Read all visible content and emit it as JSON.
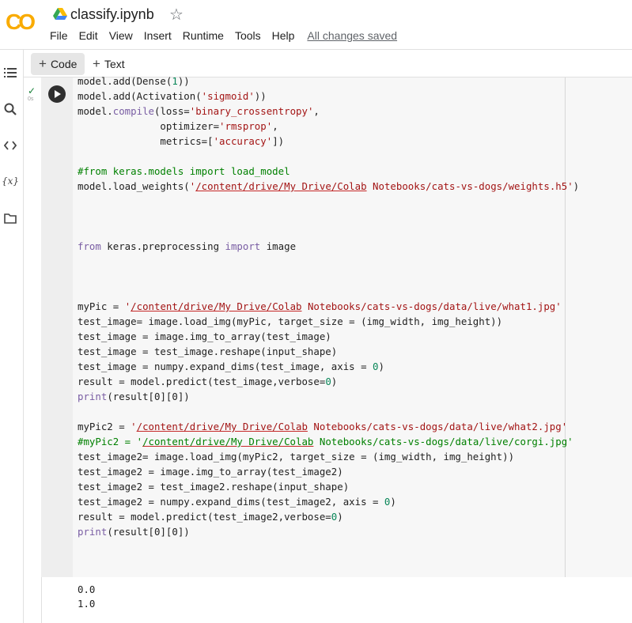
{
  "app": {
    "logo_text": "CO",
    "title": "classify.ipynb"
  },
  "menu": [
    "File",
    "Edit",
    "View",
    "Insert",
    "Runtime",
    "Tools",
    "Help"
  ],
  "save_status": "All changes saved",
  "toolbar": {
    "code_label": "Code",
    "text_label": "Text"
  },
  "sidebar": {
    "icons": [
      "table-of-contents-icon",
      "search-icon",
      "code-snippets-icon",
      "variables-icon",
      "files-icon"
    ]
  },
  "cell": {
    "status": "✓",
    "elapsed": "0s",
    "code": [
      "model.add(Dense(1))",
      "model.add(Activation('sigmoid'))",
      "model.compile(loss='binary_crossentropy',",
      "              optimizer='rmsprop',",
      "              metrics=['accuracy'])",
      "",
      "#from keras.models import load_model",
      "model.load_weights('/content/drive/My Drive/Colab Notebooks/cats-vs-dogs/weights.h5')",
      "",
      "",
      "",
      "from keras.preprocessing import image",
      "",
      "",
      "",
      "myPic = '/content/drive/My Drive/Colab Notebooks/cats-vs-dogs/data/live/what1.jpg'",
      "test_image= image.load_img(myPic, target_size = (img_width, img_height))",
      "test_image = image.img_to_array(test_image)",
      "test_image = test_image.reshape(input_shape)",
      "test_image = numpy.expand_dims(test_image, axis = 0)",
      "result = model.predict(test_image,verbose=0)",
      "print(result[0][0])",
      "",
      "myPic2 = '/content/drive/My Drive/Colab Notebooks/cats-vs-dogs/data/live/what2.jpg'",
      "#myPic2 = '/content/drive/My Drive/Colab Notebooks/cats-vs-dogs/data/live/corgi.jpg'",
      "test_image2= image.load_img(myPic2, target_size = (img_width, img_height))",
      "test_image2 = image.img_to_array(test_image2)",
      "test_image2 = test_image2.reshape(input_shape)",
      "test_image2 = numpy.expand_dims(test_image2, axis = 0)",
      "result = model.predict(test_image2,verbose=0)",
      "print(result[0][0])"
    ],
    "output": [
      "0.0",
      "1.0"
    ]
  },
  "colors": {
    "logo_orange": "#f9ab00",
    "keyword": "#795da3",
    "string": "#a31515",
    "comment": "#008000",
    "number": "#098658"
  }
}
